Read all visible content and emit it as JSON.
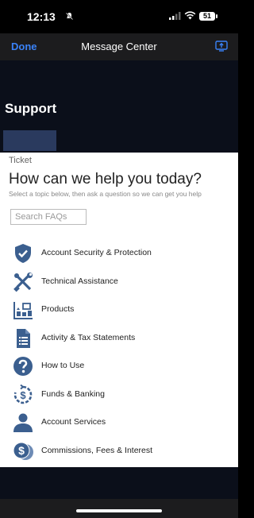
{
  "status_bar": {
    "time": "12:13",
    "battery": "51"
  },
  "nav": {
    "done_label": "Done",
    "title": "Message Center"
  },
  "header": {
    "title": "Support"
  },
  "ticket": {
    "label": "Ticket",
    "heading": "How can we help you today?",
    "subheading": "Select a topic below, then ask a question so we can get you help",
    "search_placeholder": "Search FAQs"
  },
  "topics": [
    {
      "label": "Account Security & Protection",
      "icon": "shield-check-icon"
    },
    {
      "label": "Technical Assistance",
      "icon": "wrench-screwdriver-icon"
    },
    {
      "label": "Products",
      "icon": "products-icon"
    },
    {
      "label": "Activity & Tax Statements",
      "icon": "document-list-icon"
    },
    {
      "label": "How to Use",
      "icon": "question-icon"
    },
    {
      "label": "Funds & Banking",
      "icon": "dollar-cycle-icon"
    },
    {
      "label": "Account Services",
      "icon": "person-icon"
    },
    {
      "label": "Commissions, Fees & Interest",
      "icon": "coins-dollar-icon"
    }
  ],
  "colors": {
    "icon": "#3b5f8f",
    "accent": "#3a82f7"
  }
}
